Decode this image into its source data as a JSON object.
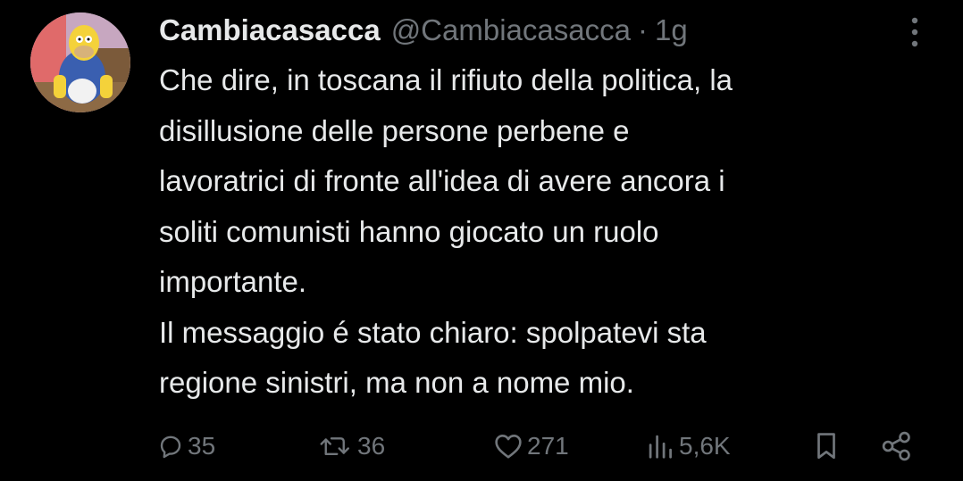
{
  "tweet": {
    "display_name": "Cambiacasacca",
    "handle": "@Cambiacasacca",
    "separator": "·",
    "time": "1g",
    "lines": [
      "Che dire, in toscana il rifiuto della politica, la",
      "disillusione delle persone perbene e",
      "lavoratrici di fronte all'idea di avere ancora i",
      "soliti comunisti hanno giocato un ruolo",
      "importante.",
      "Il messaggio é stato chiaro: spolpatevi sta",
      "regione sinistri, ma non a nome mio."
    ]
  },
  "actions": {
    "reply_count": "35",
    "retweet_count": "36",
    "like_count": "271",
    "views_count": "5,6K"
  },
  "icons": {
    "more": "more-vertical-icon",
    "reply": "reply-bubble-icon",
    "retweet": "retweet-icon",
    "like": "heart-icon",
    "views": "views-bars-icon",
    "bookmark": "bookmark-icon",
    "share": "share-icon"
  },
  "colors": {
    "background": "#000000",
    "text": "#e7e9ea",
    "secondary": "#71767b"
  }
}
